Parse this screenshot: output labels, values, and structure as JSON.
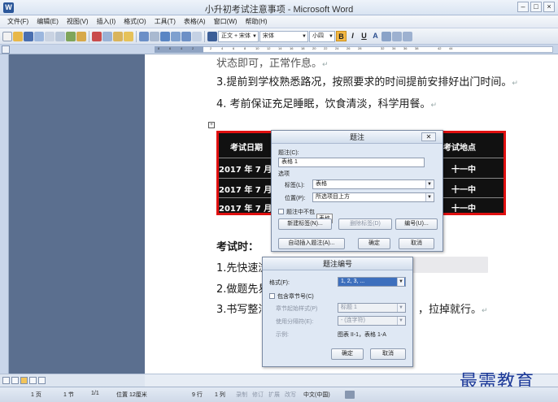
{
  "window": {
    "title": "小升初考试注意事项 - Microsoft Word",
    "app_icon": "W",
    "controls": [
      "–",
      "□",
      "×"
    ]
  },
  "menu": [
    "文件(F)",
    "编辑(E)",
    "视图(V)",
    "插入(I)",
    "格式(O)",
    "工具(T)",
    "表格(A)",
    "窗口(W)",
    "帮助(H)"
  ],
  "toolbar": {
    "style_value": "正文 + 宋体",
    "font_value": "宋体",
    "size_value": "小四",
    "bold": "B",
    "italic": "I",
    "underline": "U",
    "font_color": "A"
  },
  "ruler": {
    "ticks": [
      "8",
      "6",
      "4",
      "2",
      "2",
      "4",
      "6",
      "8",
      "10",
      "12",
      "14",
      "16",
      "18",
      "20",
      "22",
      "24",
      "26",
      "28",
      "32",
      "34",
      "36",
      "38",
      "42",
      "44"
    ]
  },
  "document": {
    "line_top_partial": "状态即可，正常作息。",
    "line_3": "3.提前到学校熟悉路况，按照要求的时间提前安排好出门时间。",
    "line_4": "4. 考前保证充足睡眠，饮食清淡，科学用餐。",
    "table": {
      "header_date": "考试日期",
      "header_place": "考试地点",
      "rows": [
        {
          "date": "2017 年 7 月 1 日",
          "place": "十一中"
        },
        {
          "date": "2017 年 7 月 1 日",
          "place": "十一中"
        },
        {
          "date": "2017 年 7 月 2 日",
          "place": "十一中"
        }
      ]
    },
    "heading": "考试时：",
    "item_1": "1.先快速浏",
    "item_2": "2.做题先易",
    "item_3": "3.书写整洁",
    "item_3_tail": "，拉掉就行。",
    "para_mark": "↵"
  },
  "caption_dialog": {
    "title": "题注",
    "caption_label": "题注(C):",
    "caption_value": "表格 1",
    "options_label": "选项",
    "label_label": "标签(L):",
    "label_value": "表格",
    "position_label": "位置(P):",
    "position_value": "所选项目上方",
    "exclude_label": "题注中不包",
    "tooltip": "表格",
    "new_label_btn": "新建标签(N)...",
    "delete_label_btn": "删除标签(D)",
    "numbering_btn": "编号(U)...",
    "auto_caption_btn": "自动插入题注(A)...",
    "ok_btn": "确定",
    "cancel_btn": "取消"
  },
  "numbering_dialog": {
    "title": "题注编号",
    "format_label": "格式(F):",
    "format_value": "1, 2, 3, ...",
    "include_chapter_label": "包含章节号(C)",
    "chapter_style_label": "章节起始样式(P)",
    "chapter_style_value": "标题 1",
    "separator_label": "使用分隔符(E):",
    "separator_value": "-  (连字符)",
    "example_label": "示例:",
    "example_value": "图表 II-1，表格 1-A",
    "ok_btn": "确定",
    "cancel_btn": "取消"
  },
  "status": {
    "page": "1 页",
    "section": "1 节",
    "page_of": "1/1",
    "position": "位置 12厘米",
    "line": "9 行",
    "column": "1 列",
    "rec": "录制",
    "trk": "修订",
    "ext": "扩展",
    "ovr": "改写",
    "language": "中文(中国)"
  },
  "watermark": "最需教育",
  "colors": {
    "accent": "#2b579a",
    "table_border": "#e01010",
    "left_pane": "#5b6f8f"
  }
}
